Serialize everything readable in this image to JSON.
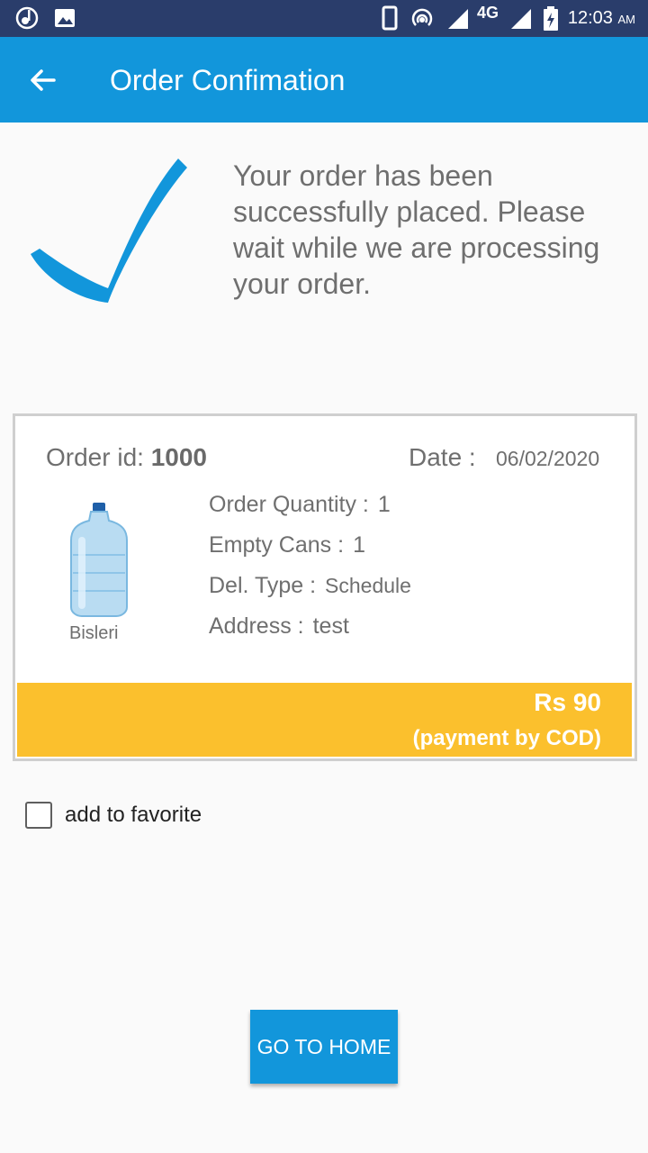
{
  "status_bar": {
    "time": "12:03",
    "ampm": "AM",
    "network": "4G",
    "icons": [
      "music-icon",
      "image-icon",
      "phone-icon",
      "hotspot-icon",
      "signal-icon",
      "battery-icon"
    ]
  },
  "app_bar": {
    "title": "Order Confimation",
    "back_icon": "arrow-left-icon"
  },
  "success": {
    "icon": "checkmark-icon",
    "message": "Your order has been successfully placed. Please wait while we are processing your order."
  },
  "order": {
    "id_label": "Order id:",
    "id_value": "1000",
    "date_label": "Date :",
    "date_value": "06/02/2020",
    "product_name": "Bisleri",
    "product_icon": "water-bottle-icon",
    "details": [
      {
        "label": "Order Quantity :",
        "value": "1"
      },
      {
        "label": "Empty Cans :",
        "value": "1"
      },
      {
        "label": "Del. Type :",
        "value": "Schedule"
      },
      {
        "label": "Address :",
        "value": "test"
      }
    ],
    "price": "Rs 90",
    "payment": "(payment by COD)"
  },
  "favorite": {
    "label": "add to favorite",
    "checked": false
  },
  "home_button": {
    "label": "GO TO HOME"
  },
  "colors": {
    "primary": "#1296db",
    "status_bar": "#2a3d6b",
    "accent": "#fbc02d"
  }
}
